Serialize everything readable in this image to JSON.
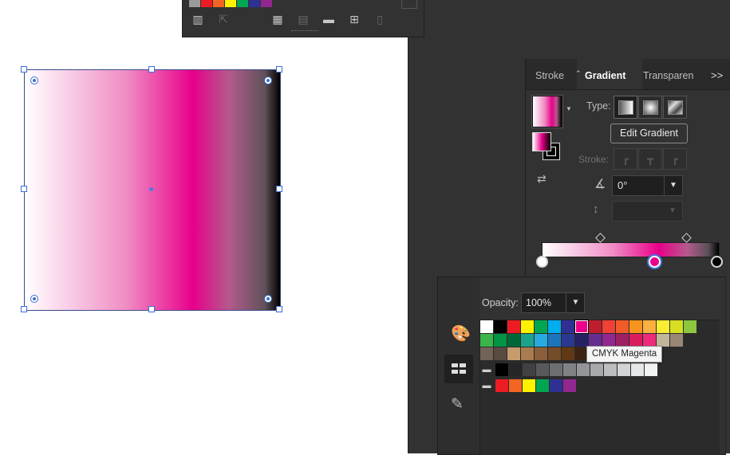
{
  "top_panel": {
    "strip_colors": [
      "#9a9a9a",
      "#ed1c24",
      "#f26522",
      "#fff200",
      "#00a651",
      "#2e3192",
      "#92278f"
    ],
    "toolbar_icons": [
      "libraries-icon",
      "place-icon",
      "swatch-kind-icon",
      "swatch-options-icon",
      "new-group-icon",
      "new-swatch-icon",
      "delete-icon"
    ]
  },
  "canvas": {
    "object": "gradient-rectangle",
    "gradient_stops": [
      "#ffffff",
      "#e8008a",
      "#000000"
    ]
  },
  "gradient_panel": {
    "tabs": [
      "Stroke",
      "Gradient",
      "Transparen"
    ],
    "active_tab": "Gradient",
    "menu_glyph": ">>",
    "type_label": "Type:",
    "edit_button": "Edit Gradient",
    "stroke_label": "Stroke:",
    "angle": "0°",
    "aspect_ratio": "",
    "stops": [
      {
        "color": "#ffffff",
        "location": 0
      },
      {
        "color": "#e8008a",
        "location": 66
      },
      {
        "color": "#000000",
        "location": 100
      }
    ],
    "midpoints": [
      33,
      83
    ]
  },
  "swatches_popover": {
    "opacity_label": "Opacity:",
    "opacity_value": "100%",
    "tooltip": "CMYK Magenta",
    "row1": [
      "#ffffff",
      "#000000",
      "#ed1c24",
      "#fff200",
      "#00a651",
      "#00aeef",
      "#2e3192",
      "#ec008c",
      "#be1e2d",
      "#ef4136",
      "#f15a29",
      "#f7941d",
      "#fbb040",
      "#f9ed32",
      "#d7df23",
      "#8dc63f"
    ],
    "row2": [
      "#39b54a",
      "#009444",
      "#006838",
      "#1ba38b",
      "#27aae1",
      "#1c75bc",
      "#2b388f",
      "#262262",
      "#662d91",
      "#92278f",
      "#9e1f63",
      "#da1c5c",
      "#ee2a7b",
      "#c2b59b",
      "#998675"
    ],
    "row3": [
      "#736357",
      "#594a42",
      "#c69c6d",
      "#a97c50",
      "#8b5e3c",
      "#754c29",
      "#603913",
      "#3c2415"
    ],
    "row4": [
      "#000000",
      "#262626",
      "#414042",
      "#58595b",
      "#6d6e71",
      "#808285",
      "#939598",
      "#a7a9ac",
      "#bcbec0",
      "#d1d3d4",
      "#e6e7e8",
      "#f1f2f2"
    ],
    "row5": [
      "#ed1c24",
      "#f26522",
      "#fff200",
      "#00a651",
      "#2e3192",
      "#92278f"
    ]
  }
}
